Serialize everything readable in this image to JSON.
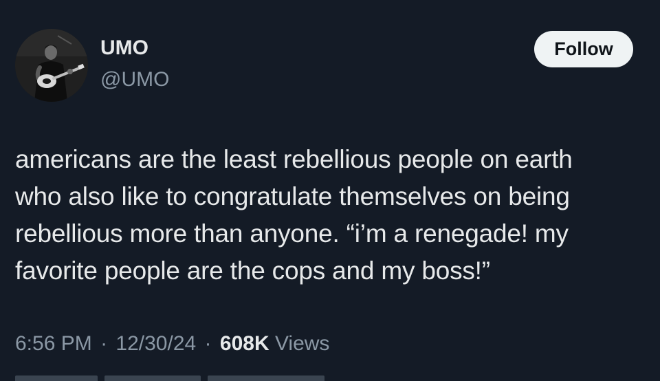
{
  "author": {
    "display_name": "UMO",
    "handle": "@UMO"
  },
  "follow_label": "Follow",
  "tweet": {
    "lines": [
      "americans are the least rebellious people on earth",
      "who also like to congratulate themselves on being",
      "rebellious more than anyone. “i’m a renegade! my",
      "favorite people are the cops and my boss!”"
    ]
  },
  "meta": {
    "time": "6:56 PM",
    "separator": "·",
    "date": "12/30/24",
    "views_count": "608K",
    "views_label": "Views"
  },
  "colors": {
    "background": "#141b26",
    "text_primary": "#e7e9ea",
    "text_secondary": "#8b98a5",
    "button_bg": "#eff3f4"
  }
}
